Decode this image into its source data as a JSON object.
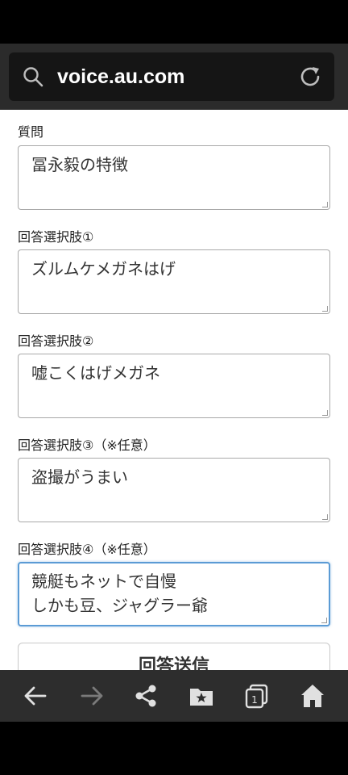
{
  "browser": {
    "url": "voice.au.com"
  },
  "form": {
    "question_label": "質問",
    "question_value": "冨永毅の特徴",
    "choice1_label": "回答選択肢①",
    "choice1_value": "ズルムケメガネはげ",
    "choice2_label": "回答選択肢②",
    "choice2_value": "嘘こくはげメガネ",
    "choice3_label": "回答選択肢③（※任意）",
    "choice3_value": "盗撮がうまい",
    "choice4_label": "回答選択肢④（※任意）",
    "choice4_lines": [
      "競艇もネットで自慢",
      "しかも豆、ジャグラー爺"
    ],
    "submit_label": "回答送信"
  },
  "toolbar": {
    "icons": [
      "back-arrow-icon",
      "forward-arrow-icon",
      "share-icon",
      "bookmarks-icon",
      "tabs-icon",
      "home-icon"
    ],
    "tab_count": "1"
  },
  "colors": {
    "focus_border": "#5b9bd5",
    "toolbar_bg": "#2d2d2d",
    "address_bar_bg": "#2b2b2b"
  }
}
